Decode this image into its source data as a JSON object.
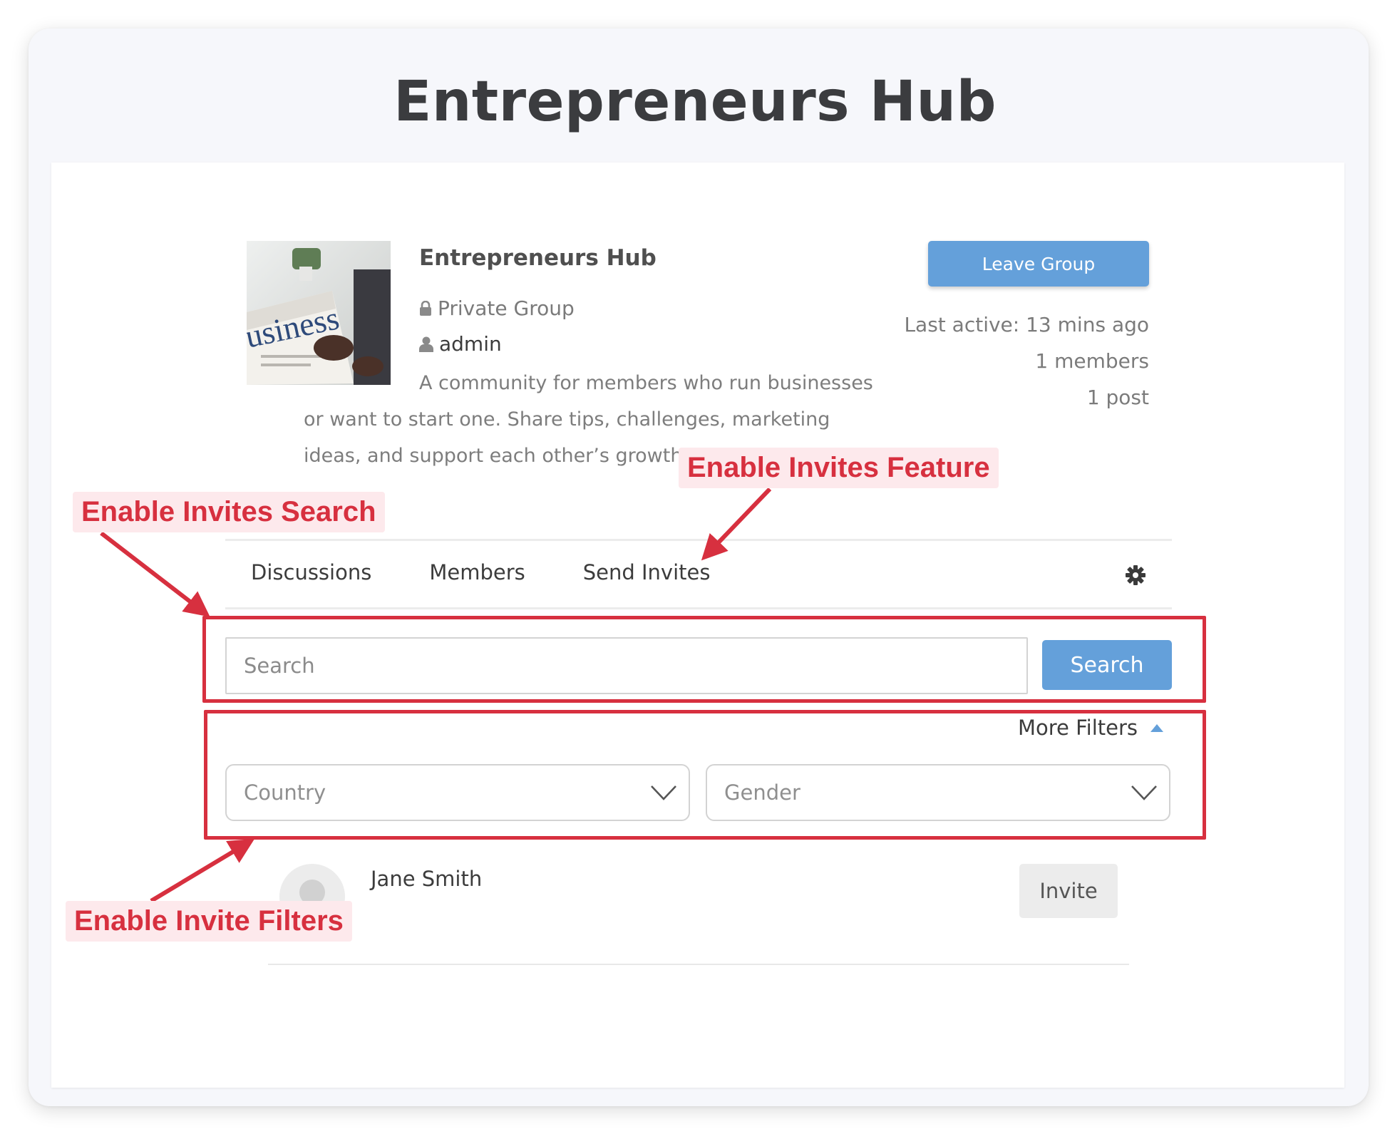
{
  "page_title": "Entrepreneurs Hub",
  "group": {
    "name": "Entrepreneurs Hub",
    "privacy": "Private Group",
    "owner": "admin",
    "description": "A community for members who run businesses or want to start one. Share tips, challenges, marketing ideas, and support each other’s growth.",
    "cover_text": "usiness"
  },
  "actions": {
    "leave_label": "Leave Group"
  },
  "stats": {
    "last_active": "Last active: 13 mins ago",
    "members": "1 members",
    "posts": "1 post"
  },
  "tabs": [
    {
      "label": "Discussions"
    },
    {
      "label": "Members"
    },
    {
      "label": "Send Invites"
    }
  ],
  "search": {
    "placeholder": "Search",
    "button_label": "Search"
  },
  "filters": {
    "toggle_label": "More Filters",
    "country_placeholder": "Country",
    "gender_placeholder": "Gender"
  },
  "members": [
    {
      "name": "Jane Smith",
      "action_label": "Invite"
    }
  ],
  "annotations": {
    "invites_feature": "Enable Invites Feature",
    "invites_search": "Enable Invites Search",
    "invite_filters": "Enable Invite Filters",
    "color": "#d7303f"
  },
  "colors": {
    "accent": "#64a0da",
    "background": "#f6f7fb"
  }
}
